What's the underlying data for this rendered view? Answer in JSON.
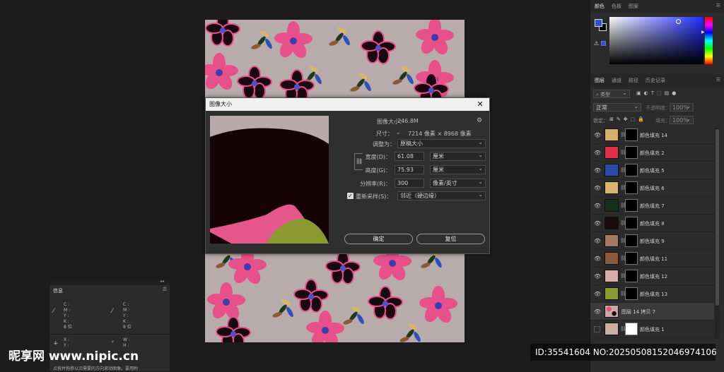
{
  "dialog": {
    "title": "图像大小",
    "image_size_label": "图像大小：",
    "image_size_value": "246.8M",
    "dimensions_label": "尺寸：",
    "dimensions_value": "7214 像素 × 8968 像素",
    "fit_label": "调整为：",
    "fit_value": "原稿大小",
    "width_label": "宽度(D)：",
    "width_value": "61.08",
    "width_unit": "厘米",
    "height_label": "高度(G)：",
    "height_value": "75.93",
    "height_unit": "厘米",
    "resolution_label": "分辨率(R)：",
    "resolution_value": "300",
    "resolution_unit": "像素/英寸",
    "resample_label": "重新采样(S)：",
    "resample_value": "邻近（硬边缘）",
    "ok_label": "确定",
    "reset_label": "复位"
  },
  "color_panel": {
    "tabs": [
      "颜色",
      "色板",
      "图案"
    ],
    "foreground": "#3a4bd8",
    "background": "#000000"
  },
  "layers_panel": {
    "tabs": [
      "图层",
      "通道",
      "路径",
      "历史记录"
    ],
    "filter_label": "类型",
    "blend_mode": "正常",
    "opacity_label": "不透明度：",
    "opacity_value": "100%",
    "lock_label": "锁定：",
    "fill_label": "填充：",
    "fill_value": "100%",
    "layers": [
      {
        "name": "颜色填充 14",
        "color": "#d4b06a",
        "visible": true
      },
      {
        "name": "颜色填充 2",
        "color": "#e0304a",
        "visible": true
      },
      {
        "name": "颜色填充 5",
        "color": "#2a4ca8",
        "visible": true
      },
      {
        "name": "颜色填充 6",
        "color": "#d8b66c",
        "visible": true
      },
      {
        "name": "颜色填充 7",
        "color": "#15301a",
        "visible": true
      },
      {
        "name": "颜色填充 8",
        "color": "#1a0c0c",
        "visible": true
      },
      {
        "name": "颜色填充 9",
        "color": "#a07866",
        "visible": true
      },
      {
        "name": "颜色填充 11",
        "color": "#8a5a36",
        "visible": true
      },
      {
        "name": "颜色填充 12",
        "color": "#d6b0a8",
        "visible": true
      },
      {
        "name": "颜色填充 13",
        "color": "#8a9a30",
        "visible": true
      },
      {
        "name": "图层 14 拷贝 7",
        "color": "#c9a8a8",
        "visible": true
      },
      {
        "name": "颜色填充 1",
        "color": "#cbb0aa",
        "visible": false
      }
    ]
  },
  "info_panel": {
    "title": "信息",
    "c_label": "C :",
    "m_label": "M :",
    "y_label": "Y :",
    "k_label": "K :",
    "bits": "8 位",
    "x_label": "X :",
    "yy_label": "Y :",
    "w_label": "W :",
    "h_label": "H :",
    "hint": "点按并拖移以沿需要的方向滚动图像。要用附"
  },
  "watermark": {
    "site": "昵享网 www.nipic.cn",
    "id": "ID:35541604 NO:20250508152046974106"
  }
}
